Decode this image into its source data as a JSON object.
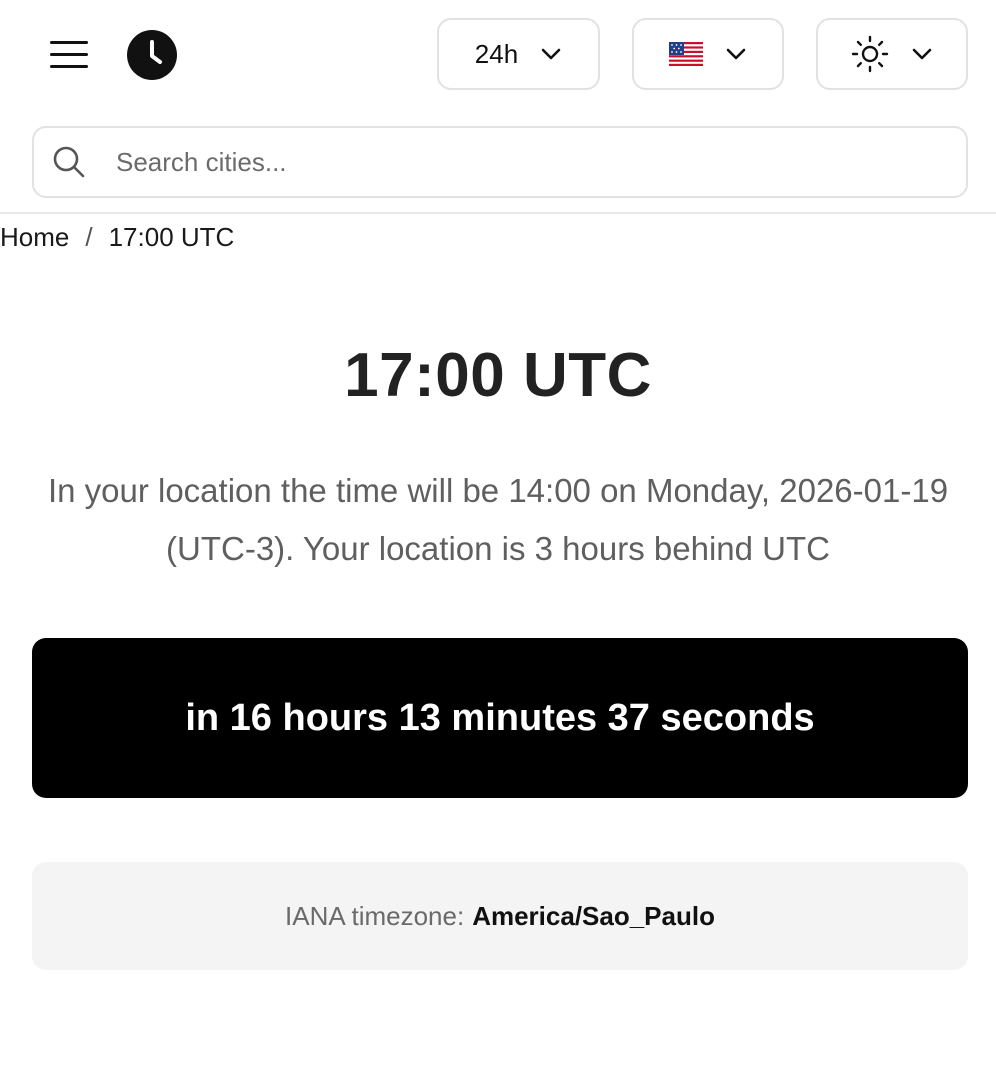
{
  "header": {
    "menu_icon": "hamburger-icon",
    "logo_icon": "clock-icon",
    "time_format": {
      "label": "24h",
      "icon": "chevron-down-icon"
    },
    "language": {
      "flag": "us-flag-icon",
      "icon": "chevron-down-icon"
    },
    "theme": {
      "icon": "sun-icon",
      "chevron": "chevron-down-icon"
    }
  },
  "search": {
    "placeholder": "Search cities...",
    "value": "",
    "icon": "search-icon"
  },
  "breadcrumb": {
    "home": "Home",
    "separator": "/",
    "current": "17:00 UTC"
  },
  "main": {
    "title": "17:00 UTC",
    "description": "In your location the time will be 14:00 on Monday, 2026-01-19 (UTC-3). Your location is 3 hours behind UTC",
    "countdown": "in 16 hours 13 minutes 37 seconds",
    "timezone_label": "IANA timezone:",
    "timezone_value": "America/Sao_Paulo"
  },
  "colors": {
    "countdown_bg": "#000000",
    "countdown_text": "#ffffff",
    "tz_box_bg": "#f4f4f4",
    "border": "#e2e2e2",
    "muted_text": "#5f5f5f"
  }
}
